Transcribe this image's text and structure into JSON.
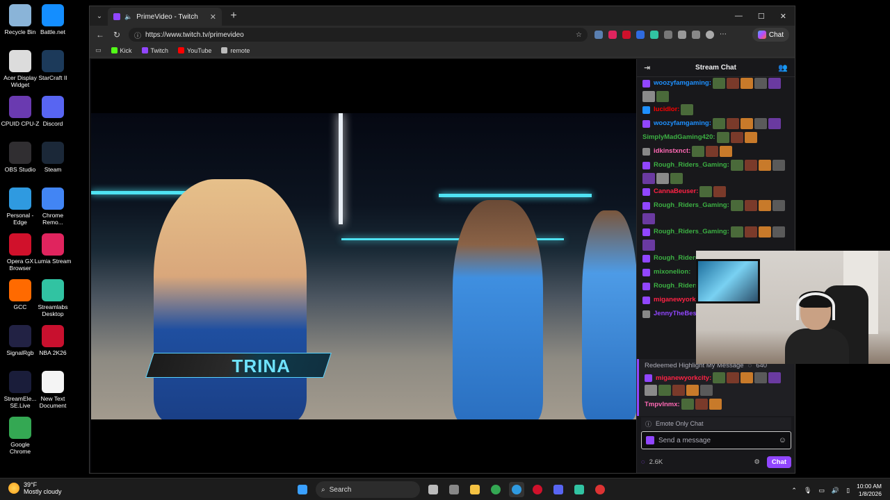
{
  "desktop": {
    "icons": [
      {
        "label": "Recycle Bin",
        "color": "#8ab4d8"
      },
      {
        "label": "Battle.net",
        "color": "#148eff"
      },
      {
        "label": "Acer Display Widget",
        "color": "#dcdcdc"
      },
      {
        "label": "StarCraft II",
        "color": "#1c3a5a"
      },
      {
        "label": "CPUID CPU-Z",
        "color": "#6a3ab0"
      },
      {
        "label": "Discord",
        "color": "#5865f2"
      },
      {
        "label": "OBS Studio",
        "color": "#302e31"
      },
      {
        "label": "Steam",
        "color": "#1b2838"
      },
      {
        "label": "Personal - Edge",
        "color": "#2f9ae0"
      },
      {
        "label": "Chrome Remo...",
        "color": "#4285f4"
      },
      {
        "label": "Opera GX Browser",
        "color": "#d0112b"
      },
      {
        "label": "Lumia Stream",
        "color": "#e0245e"
      },
      {
        "label": "GCC",
        "color": "#ff6a00"
      },
      {
        "label": "Streamlabs Desktop",
        "color": "#31c3a2"
      },
      {
        "label": "SignalRgb",
        "color": "#222244"
      },
      {
        "label": "NBA 2K26",
        "color": "#c8102e"
      },
      {
        "label": "StreamEle... SE.Live",
        "color": "#1a1d3a"
      },
      {
        "label": "New Text Document",
        "color": "#f4f4f4"
      },
      {
        "label": "Google Chrome",
        "color": "#34a853"
      }
    ]
  },
  "browser": {
    "tab_title": "PrimeVideo - Twitch",
    "url": "https://www.twitch.tv/primevideo",
    "chat_button": "Chat",
    "bookmarks": [
      {
        "label": "Kick",
        "color": "#53fc18"
      },
      {
        "label": "Twitch",
        "color": "#9146ff"
      },
      {
        "label": "YouTube",
        "color": "#ff0000"
      },
      {
        "label": "remote",
        "color": "#bbbbbb"
      }
    ]
  },
  "video": {
    "lower_third_name": "TRINA"
  },
  "chat": {
    "header": "Stream Chat",
    "messages": [
      {
        "user": "woozyfamgaming:",
        "color": "#1e90ff",
        "badge": "#9146ff",
        "emotes": 7
      },
      {
        "user": "lucidlor:",
        "color": "#ff0000",
        "badge": "#1e90ff",
        "emotes": 1
      },
      {
        "user": "woozyfamgaming:",
        "color": "#1e90ff",
        "badge": "#9146ff",
        "emotes": 5
      },
      {
        "user": "SimplyMadGaming420:",
        "color": "#3cb043",
        "badge": "",
        "emotes": 3
      },
      {
        "user": "idkinstxnct:",
        "color": "#ff69b4",
        "badge": "#888888",
        "emotes": 3
      },
      {
        "user": "Rough_Riders_Gaming:",
        "color": "#3cb043",
        "badge": "#9146ff",
        "emotes": 7
      },
      {
        "user": "CannaBeuser:",
        "color": "#ff2244",
        "badge": "#9146ff",
        "emotes": 2
      },
      {
        "user": "Rough_Riders_Gaming:",
        "color": "#3cb043",
        "badge": "#9146ff",
        "emotes": 5
      },
      {
        "user": "Rough_Riders_Gaming:",
        "color": "#3cb043",
        "badge": "#9146ff",
        "emotes": 5
      },
      {
        "user": "Rough_Riders_...",
        "color": "#3cb043",
        "badge": "#9146ff",
        "emotes": 2
      },
      {
        "user": "mixonelion:",
        "color": "#3cb043",
        "badge": "#9146ff",
        "emotes": 0
      },
      {
        "user": "Rough_Riders...",
        "color": "#3cb043",
        "badge": "#9146ff",
        "emotes": 1
      },
      {
        "user": "miganewyork...",
        "color": "#ff2244",
        "badge": "#9146ff",
        "emotes": 3
      },
      {
        "user": "JennyTheBes...",
        "color": "#9146ff",
        "badge": "#888888",
        "emotes": 1
      }
    ],
    "highlight": {
      "title": "Redeemed Highlight My Message",
      "points": "640",
      "user": "miganewyorkcity:",
      "user_color": "#ff2244",
      "emotes": 10
    },
    "last_message": {
      "user": "Tmpvlnmx:",
      "color": "#ff69b4",
      "emotes": 3
    },
    "emote_only": "Emote Only Chat",
    "input_placeholder": "Send a message",
    "points_balance": "2.6K",
    "send_label": "Chat"
  },
  "taskbar": {
    "temperature": "39°F",
    "weather": "Mostly cloudy",
    "search_label": "Search",
    "time": "10:00 AM",
    "date": "1/8/2026"
  }
}
